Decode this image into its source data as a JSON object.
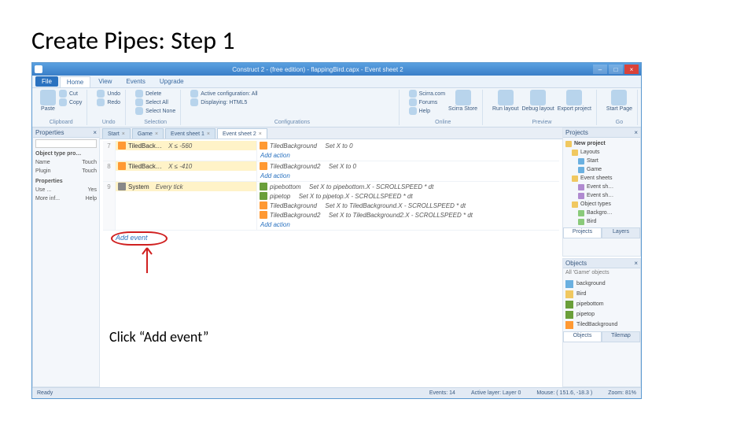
{
  "slide": {
    "title": "Create Pipes: Step 1",
    "caption": "Click “Add event”"
  },
  "window": {
    "title": "Construct 2 - (free edition) - flappingBird.capx - Event sheet 2",
    "minimize": "–",
    "maximize": "□",
    "close": "×"
  },
  "menu": {
    "file": "File",
    "tabs": [
      "Home",
      "View",
      "Events",
      "Upgrade"
    ],
    "active": "Home"
  },
  "ribbon": {
    "groups": {
      "clipboard": {
        "label": "Clipboard",
        "paste": "Paste",
        "cut": "Cut",
        "copy": "Copy"
      },
      "undo": {
        "label": "Undo",
        "undo": "Undo",
        "redo": "Redo"
      },
      "selection": {
        "label": "Selection",
        "delete": "Delete",
        "selectall": "Select All",
        "selectnone": "Select None"
      },
      "config": {
        "label": "Configurations",
        "active": "Active configuration: All",
        "displaying": "Displaying: HTML5"
      },
      "online": {
        "label": "Online",
        "scirra": "Scirra.com",
        "forums": "Forums",
        "help": "Help",
        "store": "Scirra Store"
      },
      "preview": {
        "label": "Preview",
        "run": "Run layout",
        "debug": "Debug layout",
        "export": "Export project"
      },
      "go": {
        "label": "Go",
        "start": "Start Page"
      }
    }
  },
  "properties": {
    "title": "Properties",
    "close": "×",
    "search_placeholder": "",
    "section": "Object type pro…",
    "rows": [
      {
        "k": "Name",
        "v": "Touch"
      },
      {
        "k": "Plugin",
        "v": "Touch"
      }
    ],
    "section2": "Properties",
    "rows2": [
      {
        "k": "Use ...",
        "v": "Yes"
      },
      {
        "k": "More inf...",
        "v": "Help"
      }
    ]
  },
  "docTabs": [
    {
      "label": "Start",
      "active": false
    },
    {
      "label": "Game",
      "active": false
    },
    {
      "label": "Event sheet 1",
      "active": false
    },
    {
      "label": "Event sheet 2",
      "active": true
    }
  ],
  "events": [
    {
      "n": "7",
      "cond": {
        "ico": "oc-bg",
        "obj": "TiledBack…",
        "expr": "X ≤  -560"
      },
      "acts": [
        {
          "ico": "oc-bg",
          "obj": "TiledBackground",
          "txt": "Set X to 0"
        }
      ],
      "add": true
    },
    {
      "n": "8",
      "cond": {
        "ico": "oc-bg",
        "obj": "TiledBack…",
        "expr": "X ≤  -410"
      },
      "acts": [
        {
          "ico": "oc-bg",
          "obj": "TiledBackground2",
          "txt": "Set X to 0"
        }
      ],
      "add": true
    },
    {
      "n": "9",
      "cond": {
        "ico": "oc-sys",
        "obj": "System",
        "expr": "Every tick"
      },
      "acts": [
        {
          "ico": "oc-pipe",
          "obj": "pipebottom",
          "txt": "Set X to pipebottom.X - SCROLLSPEED * dt"
        },
        {
          "ico": "oc-pipe",
          "obj": "pipetop",
          "txt": "Set X to pipetop.X - SCROLLSPEED * dt"
        },
        {
          "ico": "oc-bg",
          "obj": "TiledBackground",
          "txt": "Set X to TiledBackground.X - SCROLLSPEED * dt"
        },
        {
          "ico": "oc-bg",
          "obj": "TiledBackground2",
          "txt": "Set X to TiledBackground2.X - SCROLLSPEED * dt"
        }
      ],
      "add": true
    }
  ],
  "addAction": "Add action",
  "addEvent": "Add event",
  "projects": {
    "title": "Projects",
    "close": "×",
    "root": "New project",
    "items": [
      {
        "ico": "ti-folder",
        "label": "Layouts",
        "indent": 1
      },
      {
        "ico": "ti-layout",
        "label": "Start",
        "indent": 2
      },
      {
        "ico": "ti-layout",
        "label": "Game",
        "indent": 2
      },
      {
        "ico": "ti-folder",
        "label": "Event sheets",
        "indent": 1
      },
      {
        "ico": "ti-sheet",
        "label": "Event sh…",
        "indent": 2
      },
      {
        "ico": "ti-sheet",
        "label": "Event sh…",
        "indent": 2
      },
      {
        "ico": "ti-folder",
        "label": "Object types",
        "indent": 1
      },
      {
        "ico": "ti-type",
        "label": "Backgro…",
        "indent": 2
      },
      {
        "ico": "ti-type",
        "label": "Bird",
        "indent": 2
      }
    ],
    "tabs": [
      "Projects",
      "Layers"
    ]
  },
  "objects": {
    "title": "Objects",
    "close": "×",
    "filter": "All 'Game' objects",
    "items": [
      {
        "color": "#6ab0e0",
        "label": "background"
      },
      {
        "color": "#f0c860",
        "label": "Bird"
      },
      {
        "color": "#6a9f3a",
        "label": "pipebottom"
      },
      {
        "color": "#6a9f3a",
        "label": "pipetop"
      },
      {
        "color": "#ff9933",
        "label": "TiledBackground"
      }
    ],
    "tabs": [
      "Objects",
      "Tilemap"
    ]
  },
  "status": {
    "ready": "Ready",
    "events": "Events: 14",
    "layer": "Active layer: Layer 0",
    "mouse": "Mouse: ( 151.6, -18.3 )",
    "zoom": "Zoom: 81%"
  }
}
